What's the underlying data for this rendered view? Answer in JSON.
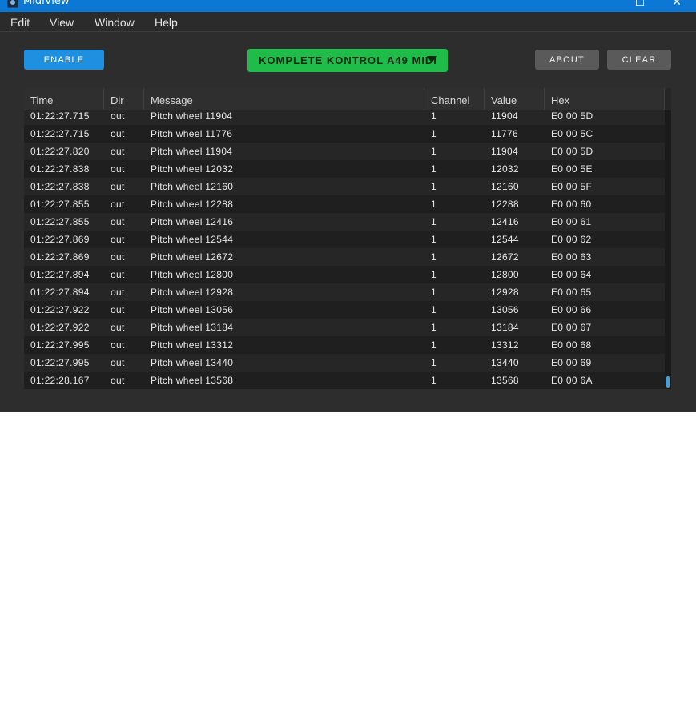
{
  "window": {
    "title": "MidiView",
    "maximize_glyph": "☐",
    "close_glyph": "✕"
  },
  "menu": [
    "Edit",
    "View",
    "Window",
    "Help"
  ],
  "toolbar": {
    "enable_label": "ENABLE",
    "device_label": "KOMPLETE KONTROL A49 MIDI",
    "about_label": "ABOUT",
    "clear_label": "CLEAR"
  },
  "colors": {
    "accent_blue": "#1f8fe0",
    "device_green": "#1fbc4a",
    "titlebar": "#0a78d4"
  },
  "table": {
    "columns": [
      "Time",
      "Dir",
      "Message",
      "Channel",
      "Value",
      "Hex"
    ],
    "rows": [
      [
        "01:22:27.715",
        "out",
        "Pitch wheel 11904",
        "1",
        "11904",
        "E0 00 5D"
      ],
      [
        "01:22:27.715",
        "out",
        "Pitch wheel 11776",
        "1",
        "11776",
        "E0 00 5C"
      ],
      [
        "01:22:27.820",
        "out",
        "Pitch wheel 11904",
        "1",
        "11904",
        "E0 00 5D"
      ],
      [
        "01:22:27.838",
        "out",
        "Pitch wheel 12032",
        "1",
        "12032",
        "E0 00 5E"
      ],
      [
        "01:22:27.838",
        "out",
        "Pitch wheel 12160",
        "1",
        "12160",
        "E0 00 5F"
      ],
      [
        "01:22:27.855",
        "out",
        "Pitch wheel 12288",
        "1",
        "12288",
        "E0 00 60"
      ],
      [
        "01:22:27.855",
        "out",
        "Pitch wheel 12416",
        "1",
        "12416",
        "E0 00 61"
      ],
      [
        "01:22:27.869",
        "out",
        "Pitch wheel 12544",
        "1",
        "12544",
        "E0 00 62"
      ],
      [
        "01:22:27.869",
        "out",
        "Pitch wheel 12672",
        "1",
        "12672",
        "E0 00 63"
      ],
      [
        "01:22:27.894",
        "out",
        "Pitch wheel 12800",
        "1",
        "12800",
        "E0 00 64"
      ],
      [
        "01:22:27.894",
        "out",
        "Pitch wheel 12928",
        "1",
        "12928",
        "E0 00 65"
      ],
      [
        "01:22:27.922",
        "out",
        "Pitch wheel 13056",
        "1",
        "13056",
        "E0 00 66"
      ],
      [
        "01:22:27.922",
        "out",
        "Pitch wheel 13184",
        "1",
        "13184",
        "E0 00 67"
      ],
      [
        "01:22:27.995",
        "out",
        "Pitch wheel 13312",
        "1",
        "13312",
        "E0 00 68"
      ],
      [
        "01:22:27.995",
        "out",
        "Pitch wheel 13440",
        "1",
        "13440",
        "E0 00 69"
      ],
      [
        "01:22:28.167",
        "out",
        "Pitch wheel 13568",
        "1",
        "13568",
        "E0 00 6A"
      ]
    ]
  }
}
